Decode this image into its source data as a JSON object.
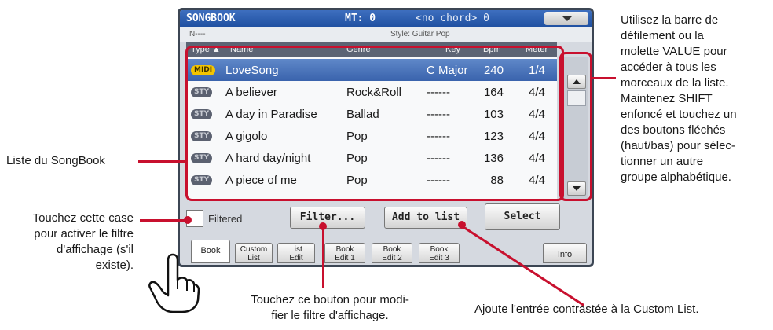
{
  "screen": {
    "title": "SONGBOOK",
    "mt": "MT: 0",
    "chord": "<no chord> 0",
    "name_field": "N----",
    "style_field": "Style: Guitar Pop",
    "columns": {
      "type": "Type ▲",
      "name": "Name",
      "genre": "Genre",
      "key": "Key",
      "bpm": "Bpm",
      "meter": "Meter"
    },
    "rows": [
      {
        "tag": "MIDI",
        "name": "LoveSong",
        "genre": "",
        "key": "C Major",
        "bpm": "240",
        "meter": "1/4"
      },
      {
        "tag": "STY",
        "name": "A believer",
        "genre": "Rock&Roll",
        "key": "------",
        "bpm": "164",
        "meter": "4/4"
      },
      {
        "tag": "STY",
        "name": "A day in Paradise",
        "genre": "Ballad",
        "key": "------",
        "bpm": "103",
        "meter": "4/4"
      },
      {
        "tag": "STY",
        "name": "A gigolo",
        "genre": "Pop",
        "key": "------",
        "bpm": "123",
        "meter": "4/4"
      },
      {
        "tag": "STY",
        "name": "A hard day/night",
        "genre": "Pop",
        "key": "------",
        "bpm": "136",
        "meter": "4/4"
      },
      {
        "tag": "STY",
        "name": "A piece of me",
        "genre": "Pop",
        "key": "------",
        "bpm": "88",
        "meter": "4/4"
      }
    ],
    "filtered_label": "Filtered",
    "filter_button": "Filter...",
    "add_button": "Add to list",
    "select_button": "Select",
    "tabs": {
      "book": "Book",
      "custom_1": "Custom",
      "custom_2": "List",
      "listedit_1": "List",
      "listedit_2": "Edit",
      "edit1_1": "Book",
      "edit1_2": "Edit 1",
      "edit2_1": "Book",
      "edit2_2": "Edit 2",
      "edit3_1": "Book",
      "edit3_2": "Edit 3",
      "info": "Info"
    }
  },
  "annotations": {
    "scroll": [
      "Utilisez la barre de",
      "défilement ou la",
      "molette VALUE pour",
      "accéder à tous les",
      "morceaux de la liste.",
      "Maintenez SHIFT",
      "enfoncé et touchez un",
      "des boutons fléchés",
      "(haut/bas) pour sélec-",
      "tionner un autre",
      "groupe alphabétique."
    ],
    "list": "Liste du SongBook",
    "filter_box": [
      "Touchez cette case",
      "pour activer le filtre",
      "d'affichage (s'il",
      "existe)."
    ],
    "filter_button": [
      "Touchez ce bouton pour modi-",
      "fier le filtre d'affichage."
    ],
    "add": "Ajoute l'entrée contrastée à la Custom List."
  },
  "colors": {
    "highlight": "#c8102e",
    "selected_row": "#3a63ad",
    "title_bar": "#1e4fa0"
  }
}
